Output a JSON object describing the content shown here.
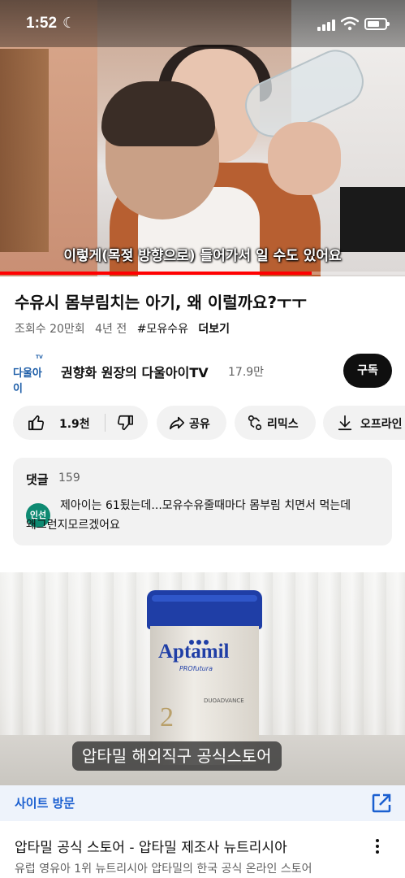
{
  "status_bar": {
    "time": "1:52",
    "moon_icon": "moon-icon",
    "signal_icon": "cellular-signal-icon",
    "wifi_icon": "wifi-icon",
    "battery_icon": "battery-icon"
  },
  "player": {
    "subtitle": "이렇게(목젖 방향으로) 들어가서 일 수도 있어요",
    "progress": 0.77,
    "progress_color": "#ff0000"
  },
  "video": {
    "title": "수유시 몸부림치는 아기, 왜 이럴까요?ㅜㅜ",
    "views": "조회수 20만회",
    "age": "4년 전",
    "hashtag": "#모유수유",
    "more": "더보기"
  },
  "channel": {
    "logo_text": "다울아이",
    "logo_tv": "TV",
    "name": "권향화 원장의 다울아이TV",
    "subscribers": "17.9만",
    "subscribe_label": "구독"
  },
  "actions": {
    "like_count": "1.9천",
    "share": "공유",
    "remix": "리믹스",
    "offline": "오프라인"
  },
  "comments": {
    "header": "댓글",
    "count": "159",
    "avatar_text": "인선",
    "top_comment_line1": "제아이는 61됬는데...모유수유줄때마다 몸부림 치면서 먹는데",
    "top_comment_line2": "왜그런지모르겠어요"
  },
  "ad": {
    "product_brand": "Aptamil",
    "product_sub": "PROfutura",
    "product_stage": "2",
    "product_type": "DUOADVANCE",
    "caption": "압타밀 해외직구 공식스토어",
    "visit_label": "사이트 방문",
    "title": "압타밀 공식 스토어 - 압타밀 제조사 뉴트리시아",
    "description": "유럽 영유아 1위 뉴트리시아 압타밀의 한국 공식 온라인 스토어",
    "accent_color": "#1a5fd0"
  }
}
